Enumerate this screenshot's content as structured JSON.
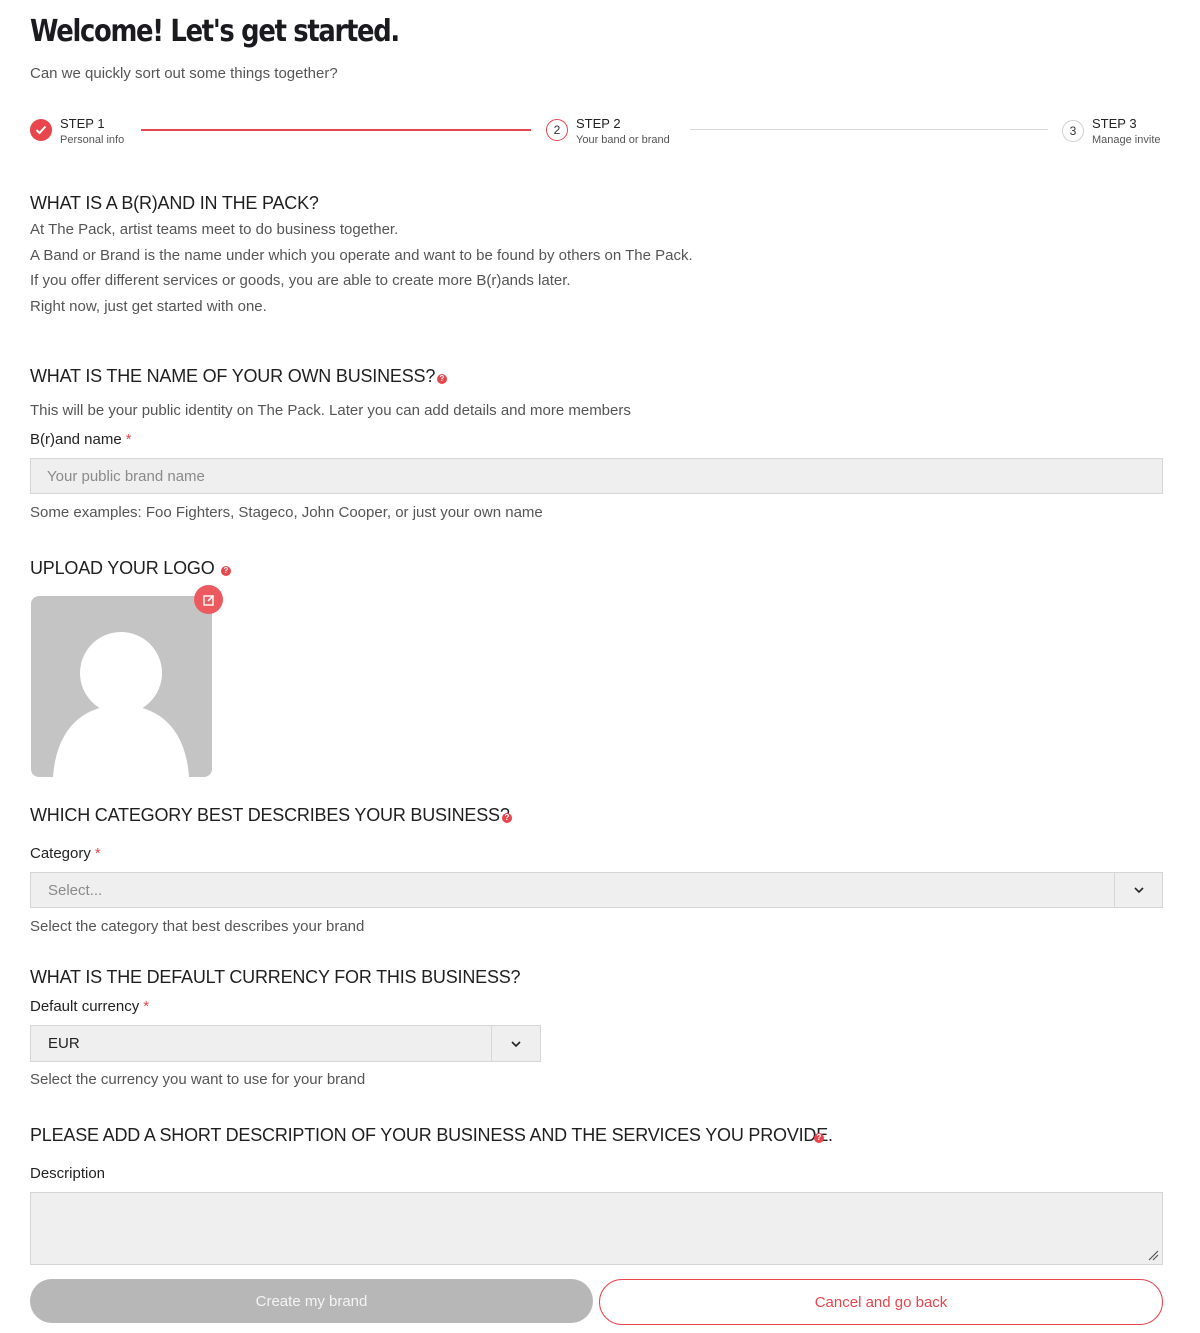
{
  "header": {
    "title": "Welcome! Let's get started.",
    "subtitle": "Can we quickly sort out some things together?"
  },
  "stepper": {
    "steps": [
      {
        "number": "1",
        "title": "STEP 1",
        "subtitle": "Personal info",
        "state": "complete"
      },
      {
        "number": "2",
        "title": "STEP 2",
        "subtitle": "Your band or brand",
        "state": "current"
      },
      {
        "number": "3",
        "title": "STEP 3",
        "subtitle": "Manage invite",
        "state": "upcoming"
      }
    ]
  },
  "intro": {
    "heading": "WHAT IS A B(R)AND IN THE PACK?",
    "lines": [
      "At The Pack, artist teams meet to do business together.",
      "A Band or Brand is the name under which you operate and want to be found by others on The Pack.",
      "If you offer different services or goods, you are able to create more B(r)ands later.",
      "Right now, just get started with one."
    ]
  },
  "name_section": {
    "heading": "WHAT IS THE NAME OF YOUR OWN BUSINESS?",
    "help_icon": "question-icon",
    "description": "This will be your public identity on The Pack. Later you can add details and more members",
    "label": "B(r)and name",
    "required_mark": "*",
    "placeholder": "Your public brand name",
    "hint": "Some examples: Foo Fighters, Stageco, John Cooper, or just your own name"
  },
  "logo_section": {
    "heading": "UPLOAD YOUR LOGO",
    "help_icon": "question-icon",
    "edit_icon": "edit-icon"
  },
  "category_section": {
    "heading": "WHICH CATEGORY BEST DESCRIBES YOUR BUSINESS?",
    "help_icon": "question-icon",
    "label": "Category",
    "required_mark": "*",
    "placeholder": "Select...",
    "hint": "Select the category that best describes your brand"
  },
  "currency_section": {
    "heading": "WHAT IS THE DEFAULT CURRENCY FOR THIS BUSINESS?",
    "label": "Default currency",
    "required_mark": "*",
    "value": "EUR",
    "hint": "Select the currency you want to use for your brand"
  },
  "description_section": {
    "heading": "PLEASE ADD A SHORT DESCRIPTION OF YOUR BUSINESS AND THE SERVICES YOU PROVIDE.",
    "help_icon": "question-icon",
    "label": "Description",
    "value": ""
  },
  "actions": {
    "primary_label": "Create my brand",
    "secondary_label": "Cancel and go back"
  },
  "colors": {
    "accent": "#e8454d",
    "disabled_button": "#b7b7b7",
    "input_bg": "#efefef"
  }
}
